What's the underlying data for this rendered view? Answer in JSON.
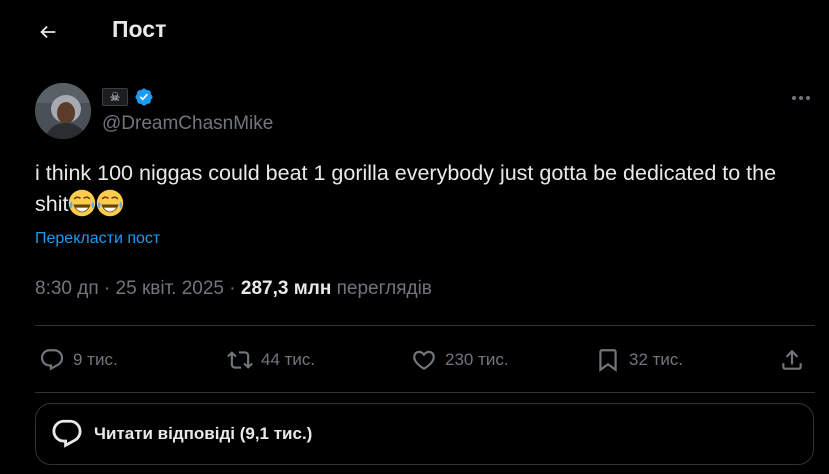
{
  "header": {
    "title": "Пост"
  },
  "author": {
    "display_name_emoji": "☠",
    "handle": "@DreamChasnMike",
    "verified": true
  },
  "tweet": {
    "text": "i think 100 niggas could beat 1 gorilla everybody just gotta be dedicated to the shit",
    "emojis": [
      "😂",
      "😂"
    ],
    "translate_label": "Перекласти пост"
  },
  "meta": {
    "time": "8:30 дп",
    "separator": "·",
    "date": "25 квіт. 2025",
    "views_count": "287,3 млн",
    "views_label": "переглядів"
  },
  "actions": {
    "replies": "9 тис.",
    "reposts": "44 тис.",
    "likes": "230 тис.",
    "bookmarks": "32 тис."
  },
  "replies_bar": {
    "label": "Читати відповіді (9,1 тис.)"
  },
  "colors": {
    "accent": "#1d9bf0",
    "muted": "#71767b",
    "text": "#e7e9ea",
    "divider": "#2f3336"
  },
  "icons": [
    "back-arrow-icon",
    "verified-badge-icon",
    "more-icon",
    "reply-icon",
    "repost-icon",
    "like-icon",
    "bookmark-icon",
    "share-icon",
    "replies-bubble-icon"
  ]
}
